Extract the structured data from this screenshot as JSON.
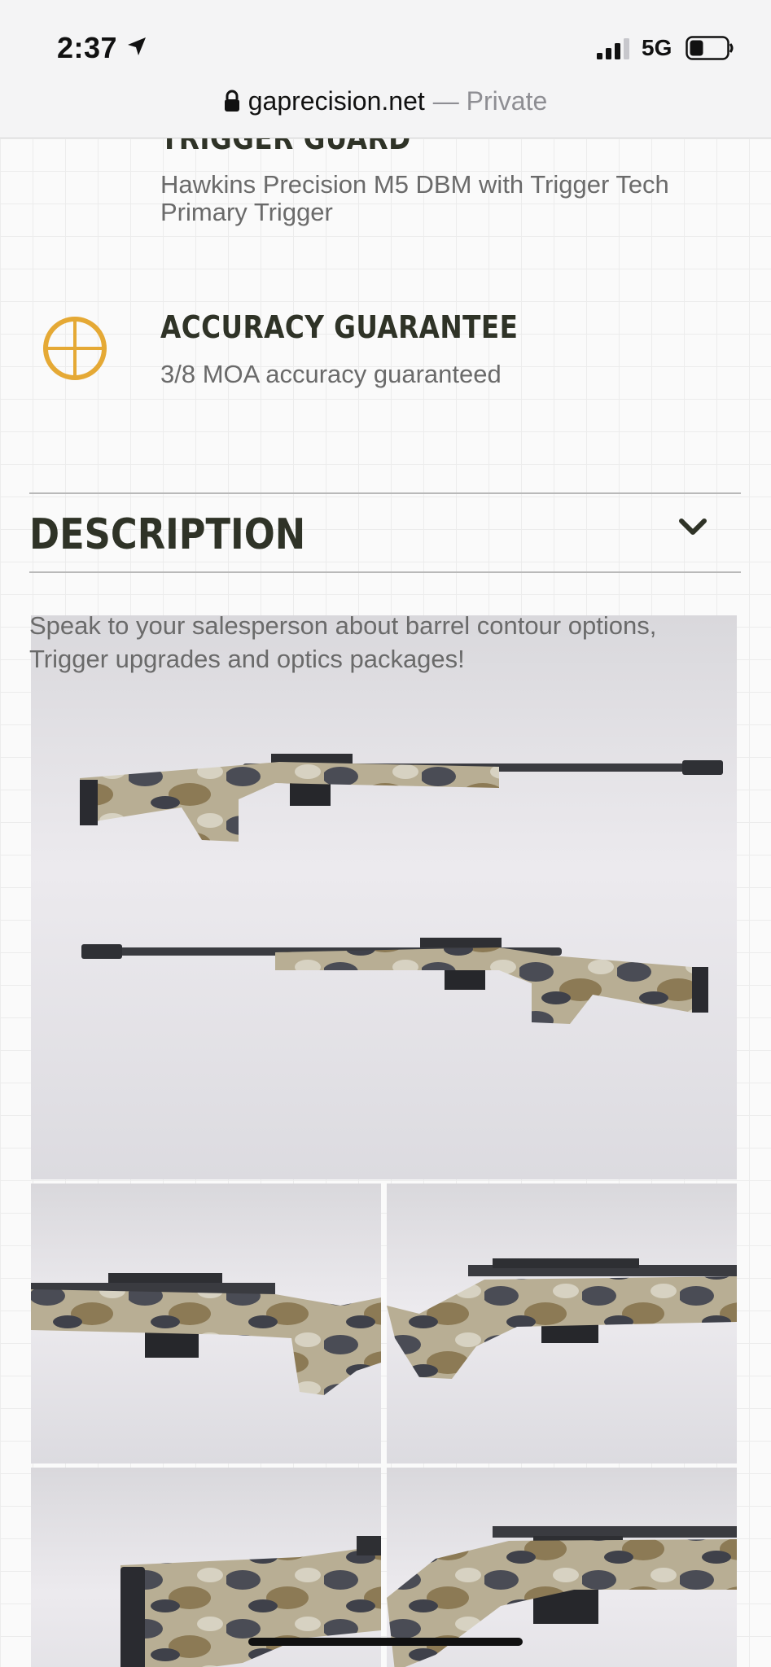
{
  "status_bar": {
    "time": "2:37",
    "network": "5G",
    "icons": [
      "location-arrow-icon",
      "signal-icon",
      "battery-icon"
    ]
  },
  "url_bar": {
    "domain": "gaprecision.net",
    "separator": "—",
    "mode": "Private",
    "icon": "lock-icon"
  },
  "features": [
    {
      "heading": "TRIGGER GUARD",
      "text_line1": "Hawkins Precision M5 DBM with Trigger Tech",
      "text_line2": "Primary Trigger"
    },
    {
      "heading": "ACCURACY GUARANTEE",
      "text": "3/8 MOA accuracy guaranteed",
      "icon": "crosshair-icon"
    }
  ],
  "description": {
    "title": "DESCRIPTION",
    "toggle_icon": "chevron-down-icon",
    "text_line1": "Speak to your salesperson about barrel contour options,",
    "text_line2": "Trigger upgrades and optics packages!"
  },
  "images": [
    {
      "name": "rifle-both-sides"
    },
    {
      "name": "rifle-stock-left"
    },
    {
      "name": "rifle-action-right"
    },
    {
      "name": "rifle-buttstock-left"
    },
    {
      "name": "rifle-magazine-right"
    }
  ],
  "colors": {
    "accent": "#e5a935",
    "heading": "#2f3327",
    "body_text": "#6a6a6a"
  }
}
